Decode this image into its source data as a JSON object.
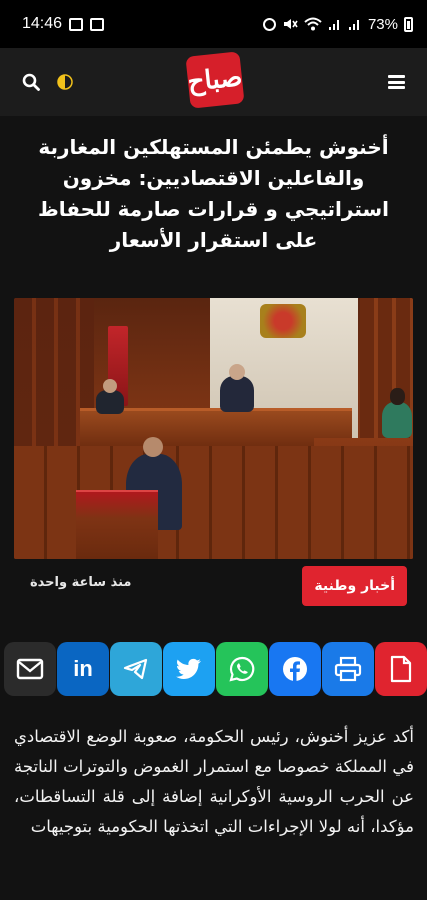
{
  "status_bar": {
    "time": "14:46",
    "battery": "73%"
  },
  "header": {
    "logo_text": "صباح",
    "icons": [
      "search-icon",
      "theme-toggle-icon",
      "menu-icon"
    ]
  },
  "article": {
    "title": "أخنوش يطمئن المستهلكين المغاربة والفاعلين الاقتصاديين: مخزون استراتيجي و قرارات صارمة للحفاظ على استقرار الأسعار",
    "category": "أخبار وطنية",
    "time_ago": "منذ ساعة واحدة",
    "body": "أكد عزيز أخنوش، رئيس الحكومة، صعوبة الوضع الاقتصادي في المملكة خصوصا مع استمرار الغموض والتوترات الناتجة عن الحرب الروسية الأوكرانية إضافة إلى قلة التساقطات، مؤكدا، أنه لولا الإجراءات التي اتخذتها الحكومية بتوجيهات"
  },
  "share": [
    "mail-icon",
    "linkedin-icon",
    "telegram-icon",
    "twitter-icon",
    "whatsapp-icon",
    "facebook-icon",
    "print-icon",
    "pdf-icon"
  ],
  "colors": {
    "background": "#121212",
    "header": "#1c1c1c",
    "accent_red": "#e0242f",
    "logo_red": "#d61f2a"
  }
}
